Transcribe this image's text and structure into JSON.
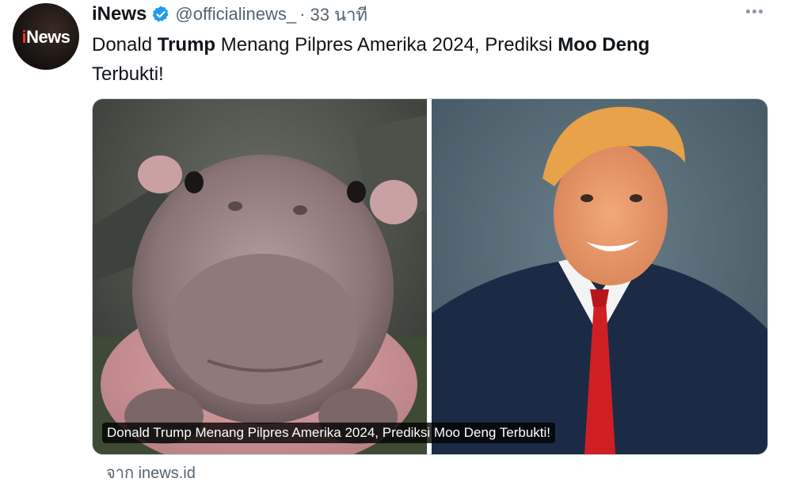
{
  "account": {
    "avatar_text_i": "i",
    "avatar_text_rest": "News",
    "display_name": "iNews",
    "handle": "@officialinews_",
    "separator": "·",
    "time": "33 นาที",
    "verified_color": "#1d9bf0"
  },
  "tweet": {
    "text_parts": [
      {
        "text": "Donald ",
        "bold": false
      },
      {
        "text": "Trump",
        "bold": true
      },
      {
        "text": " Menang Pilpres Amerika 2024, Prediksi ",
        "bold": false
      },
      {
        "text": "Moo Deng",
        "bold": true
      },
      {
        "text": " Terbukti!",
        "bold": false
      }
    ]
  },
  "media": {
    "caption": "Donald Trump Menang Pilpres Amerika 2024, Prediksi Moo Deng Terbukti!",
    "left_image": "baby-pygmy-hippo-photo",
    "right_image": "man-in-suit-red-tie-photo"
  },
  "card": {
    "source": "จาก inews.id"
  },
  "icons": {
    "more": "more-options-icon",
    "verified": "verified-badge-icon"
  }
}
